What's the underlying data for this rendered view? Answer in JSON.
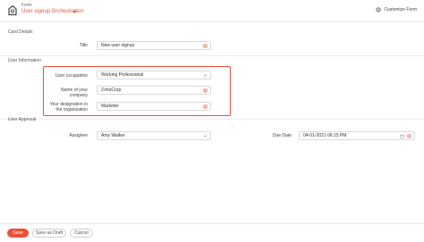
{
  "header": {
    "kicker": "Form",
    "form_name": "User signup Orchestration",
    "customize_label": "Customize Form"
  },
  "sections": {
    "card_details": "Card Details",
    "user_information": "User Information",
    "user_approval": "User Approval"
  },
  "fields": {
    "title": {
      "label": "Title",
      "value": "New user signup"
    },
    "occupation": {
      "label": "User occupation",
      "value": "Working Professional"
    },
    "company": {
      "label": "Name of your company",
      "value": "ZohoCorp"
    },
    "designation": {
      "label": "Your designation in the organization",
      "value": "Marketer"
    },
    "assignee": {
      "label": "Assignee",
      "value": "Amy Walker"
    },
    "due_date": {
      "label": "Due Date",
      "value": "04-01-2021 06:15 PM"
    }
  },
  "footer": {
    "save": "Save",
    "save_draft": "Save as Draft",
    "cancel": "Cancel"
  },
  "colors": {
    "accent": "#e8503a"
  },
  "icons": {
    "logo": "form-logo-icon",
    "clear": "clear-icon",
    "dropdown": "chevron-down-icon",
    "calendar": "calendar-icon",
    "customize": "gear-icon"
  }
}
